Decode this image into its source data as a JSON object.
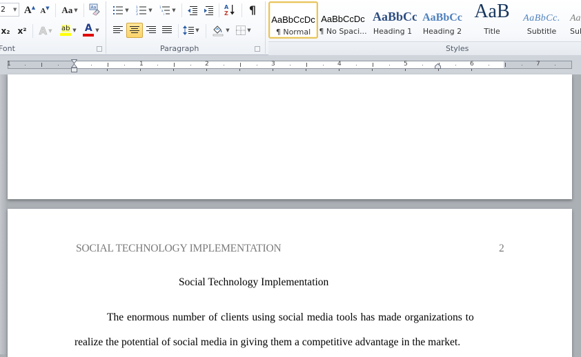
{
  "ribbon": {
    "font_group": {
      "label": "Font",
      "font_size": "2",
      "grow_font_label": "A",
      "shrink_font_label": "A",
      "change_case_label": "Aa",
      "subscript_label": "x₂",
      "superscript_label": "x²",
      "text_effects_label": "A",
      "highlight_label": "ab",
      "font_color_label": "A",
      "highlight_color": "#ffff00",
      "font_color": "#e00000"
    },
    "paragraph_group": {
      "label": "Paragraph",
      "pilcrow": "¶",
      "sort_label": "A Z"
    },
    "styles_group": {
      "label": "Styles",
      "tiles": [
        {
          "preview": "AaBbCcDc",
          "name": "¶ Normal",
          "selected": true
        },
        {
          "preview": "AaBbCcDc",
          "name": "¶ No Spaci...",
          "selected": false
        },
        {
          "preview": "AaBbCc",
          "name": "Heading 1",
          "selected": false
        },
        {
          "preview": "AaBbCc",
          "name": "Heading 2",
          "selected": false
        },
        {
          "preview": "AaB",
          "name": "Title",
          "selected": false
        },
        {
          "preview": "AaBbCc.",
          "name": "Subtitle",
          "selected": false
        },
        {
          "preview": "Aa",
          "name": "Sub",
          "selected": false
        }
      ]
    }
  },
  "ruler": {
    "numbers": [
      "1",
      "1",
      "2",
      "3",
      "4",
      "5",
      "6",
      "7"
    ]
  },
  "document": {
    "header": "SOCIAL TECHNOLOGY IMPLEMENTATION",
    "page_number": "2",
    "title": "Social Technology Implementation",
    "paragraph_lines": [
      "The enormous number of clients using social media tools has made organizations  to",
      "realize  the potential of social media in giving them a competitive advantage in the market."
    ]
  }
}
